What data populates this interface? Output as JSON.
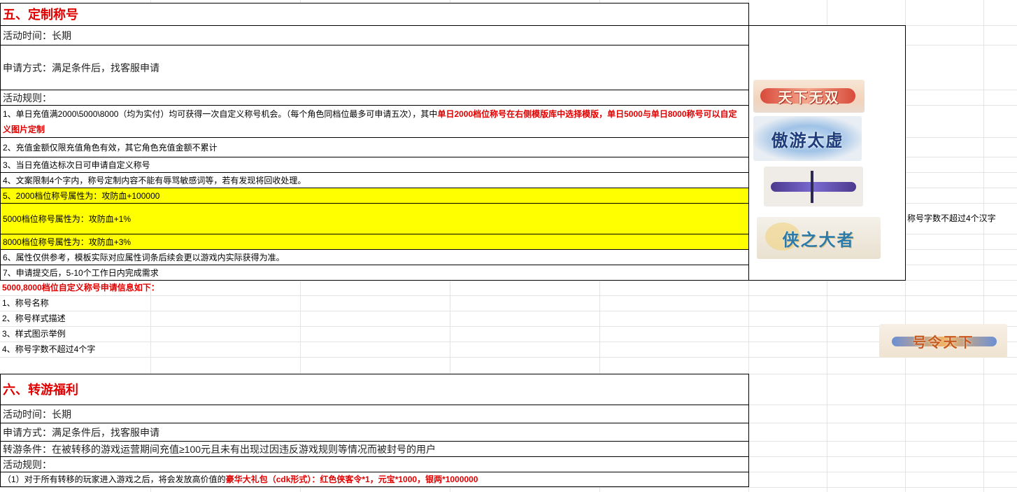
{
  "section5": {
    "title": "五、定制称号",
    "time": "活动时间：长期",
    "apply": "申请方式：满足条件后，找客服申请",
    "rules_label": "活动规则：",
    "rule1_plain": "1、单日充值满2000\\5000\\8000（均为实付）均可获得一次自定义称号机会。（每个角色同档位最多可申请五次），其中",
    "rule1_red": "单日2000档位称号在右侧模版库中选择模版，单日5000与单日8000称号可以自定义图片定制",
    "rule2": "2、充值金额仅限充值角色有效，其它角色充值金额不累计",
    "rule3": "3、当日充值达标次日可申请自定义称号",
    "rule4": "4、文案限制4个字内，称号定制内容不能有辱骂敏感词等，若有发现将回收处理。",
    "rule5": "5、2000档位称号属性为：攻防血+100000",
    "rule5b": "5000档位称号属性为：攻防血+1%",
    "rule5c": "8000档位称号属性为：攻防血+3%",
    "rule6": "6、属性仅供参考，模板实际对应属性词条后续会更以游戏内实际获得为准。",
    "rule7": "7、申请提交后，5-10个工作日内完成需求",
    "info_title": "5000,8000档位自定义称号申请信息如下：",
    "info_items": [
      "1、称号名称",
      "2、称号样式描述",
      "3、样式图示举例",
      "4、称号字数不超过4个字"
    ],
    "side_note": "称号字数不超过4个汉字",
    "badges": [
      {
        "text": "天下无双",
        "icon": "title-badge-image"
      },
      {
        "text": "傲游太虚",
        "icon": "title-badge-image"
      },
      {
        "text": "",
        "icon": "title-badge-image"
      },
      {
        "text": "侠之大者",
        "icon": "title-badge-image"
      },
      {
        "text": "号令天下",
        "icon": "title-badge-image"
      }
    ]
  },
  "section6": {
    "title": "六、转游福利",
    "time": "活动时间：长期",
    "apply": "申请方式：满足条件后，找客服申请",
    "condition": "转游条件：在被转移的游戏运营期间充值≥100元且未有出现过因违反游戏规则等情况而被封号的用户",
    "rules_label": "活动规则：",
    "rule1_plain": "（1）对于所有转移的玩家进入游戏之后，将会发放高价值的",
    "rule1_red": "豪华大礼包（cdk形式）：红色侠客令*1，元宝*1000，银两*1000000"
  },
  "colors": {
    "accent_red": "#e00000",
    "highlight_yellow": "#ffff00",
    "grid": "#e4e4e4"
  }
}
